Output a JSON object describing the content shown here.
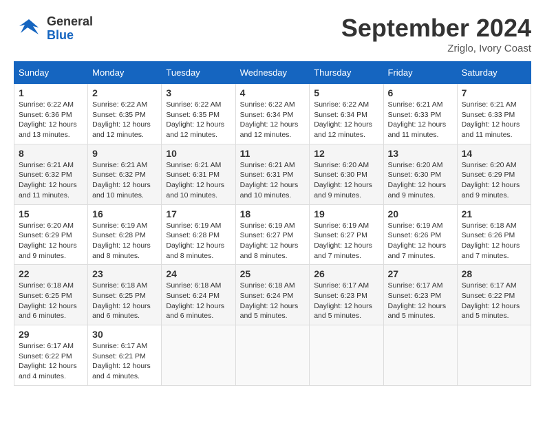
{
  "header": {
    "logo_general": "General",
    "logo_blue": "Blue",
    "month_title": "September 2024",
    "location": "Zriglo, Ivory Coast"
  },
  "weekdays": [
    "Sunday",
    "Monday",
    "Tuesday",
    "Wednesday",
    "Thursday",
    "Friday",
    "Saturday"
  ],
  "weeks": [
    [
      {
        "day": "1",
        "info": "Sunrise: 6:22 AM\nSunset: 6:36 PM\nDaylight: 12 hours\nand 13 minutes."
      },
      {
        "day": "2",
        "info": "Sunrise: 6:22 AM\nSunset: 6:35 PM\nDaylight: 12 hours\nand 12 minutes."
      },
      {
        "day": "3",
        "info": "Sunrise: 6:22 AM\nSunset: 6:35 PM\nDaylight: 12 hours\nand 12 minutes."
      },
      {
        "day": "4",
        "info": "Sunrise: 6:22 AM\nSunset: 6:34 PM\nDaylight: 12 hours\nand 12 minutes."
      },
      {
        "day": "5",
        "info": "Sunrise: 6:22 AM\nSunset: 6:34 PM\nDaylight: 12 hours\nand 12 minutes."
      },
      {
        "day": "6",
        "info": "Sunrise: 6:21 AM\nSunset: 6:33 PM\nDaylight: 12 hours\nand 11 minutes."
      },
      {
        "day": "7",
        "info": "Sunrise: 6:21 AM\nSunset: 6:33 PM\nDaylight: 12 hours\nand 11 minutes."
      }
    ],
    [
      {
        "day": "8",
        "info": "Sunrise: 6:21 AM\nSunset: 6:32 PM\nDaylight: 12 hours\nand 11 minutes."
      },
      {
        "day": "9",
        "info": "Sunrise: 6:21 AM\nSunset: 6:32 PM\nDaylight: 12 hours\nand 10 minutes."
      },
      {
        "day": "10",
        "info": "Sunrise: 6:21 AM\nSunset: 6:31 PM\nDaylight: 12 hours\nand 10 minutes."
      },
      {
        "day": "11",
        "info": "Sunrise: 6:21 AM\nSunset: 6:31 PM\nDaylight: 12 hours\nand 10 minutes."
      },
      {
        "day": "12",
        "info": "Sunrise: 6:20 AM\nSunset: 6:30 PM\nDaylight: 12 hours\nand 9 minutes."
      },
      {
        "day": "13",
        "info": "Sunrise: 6:20 AM\nSunset: 6:30 PM\nDaylight: 12 hours\nand 9 minutes."
      },
      {
        "day": "14",
        "info": "Sunrise: 6:20 AM\nSunset: 6:29 PM\nDaylight: 12 hours\nand 9 minutes."
      }
    ],
    [
      {
        "day": "15",
        "info": "Sunrise: 6:20 AM\nSunset: 6:29 PM\nDaylight: 12 hours\nand 9 minutes."
      },
      {
        "day": "16",
        "info": "Sunrise: 6:19 AM\nSunset: 6:28 PM\nDaylight: 12 hours\nand 8 minutes."
      },
      {
        "day": "17",
        "info": "Sunrise: 6:19 AM\nSunset: 6:28 PM\nDaylight: 12 hours\nand 8 minutes."
      },
      {
        "day": "18",
        "info": "Sunrise: 6:19 AM\nSunset: 6:27 PM\nDaylight: 12 hours\nand 8 minutes."
      },
      {
        "day": "19",
        "info": "Sunrise: 6:19 AM\nSunset: 6:27 PM\nDaylight: 12 hours\nand 7 minutes."
      },
      {
        "day": "20",
        "info": "Sunrise: 6:19 AM\nSunset: 6:26 PM\nDaylight: 12 hours\nand 7 minutes."
      },
      {
        "day": "21",
        "info": "Sunrise: 6:18 AM\nSunset: 6:26 PM\nDaylight: 12 hours\nand 7 minutes."
      }
    ],
    [
      {
        "day": "22",
        "info": "Sunrise: 6:18 AM\nSunset: 6:25 PM\nDaylight: 12 hours\nand 6 minutes."
      },
      {
        "day": "23",
        "info": "Sunrise: 6:18 AM\nSunset: 6:25 PM\nDaylight: 12 hours\nand 6 minutes."
      },
      {
        "day": "24",
        "info": "Sunrise: 6:18 AM\nSunset: 6:24 PM\nDaylight: 12 hours\nand 6 minutes."
      },
      {
        "day": "25",
        "info": "Sunrise: 6:18 AM\nSunset: 6:24 PM\nDaylight: 12 hours\nand 5 minutes."
      },
      {
        "day": "26",
        "info": "Sunrise: 6:17 AM\nSunset: 6:23 PM\nDaylight: 12 hours\nand 5 minutes."
      },
      {
        "day": "27",
        "info": "Sunrise: 6:17 AM\nSunset: 6:23 PM\nDaylight: 12 hours\nand 5 minutes."
      },
      {
        "day": "28",
        "info": "Sunrise: 6:17 AM\nSunset: 6:22 PM\nDaylight: 12 hours\nand 5 minutes."
      }
    ],
    [
      {
        "day": "29",
        "info": "Sunrise: 6:17 AM\nSunset: 6:22 PM\nDaylight: 12 hours\nand 4 minutes."
      },
      {
        "day": "30",
        "info": "Sunrise: 6:17 AM\nSunset: 6:21 PM\nDaylight: 12 hours\nand 4 minutes."
      },
      {
        "day": "",
        "info": ""
      },
      {
        "day": "",
        "info": ""
      },
      {
        "day": "",
        "info": ""
      },
      {
        "day": "",
        "info": ""
      },
      {
        "day": "",
        "info": ""
      }
    ]
  ]
}
